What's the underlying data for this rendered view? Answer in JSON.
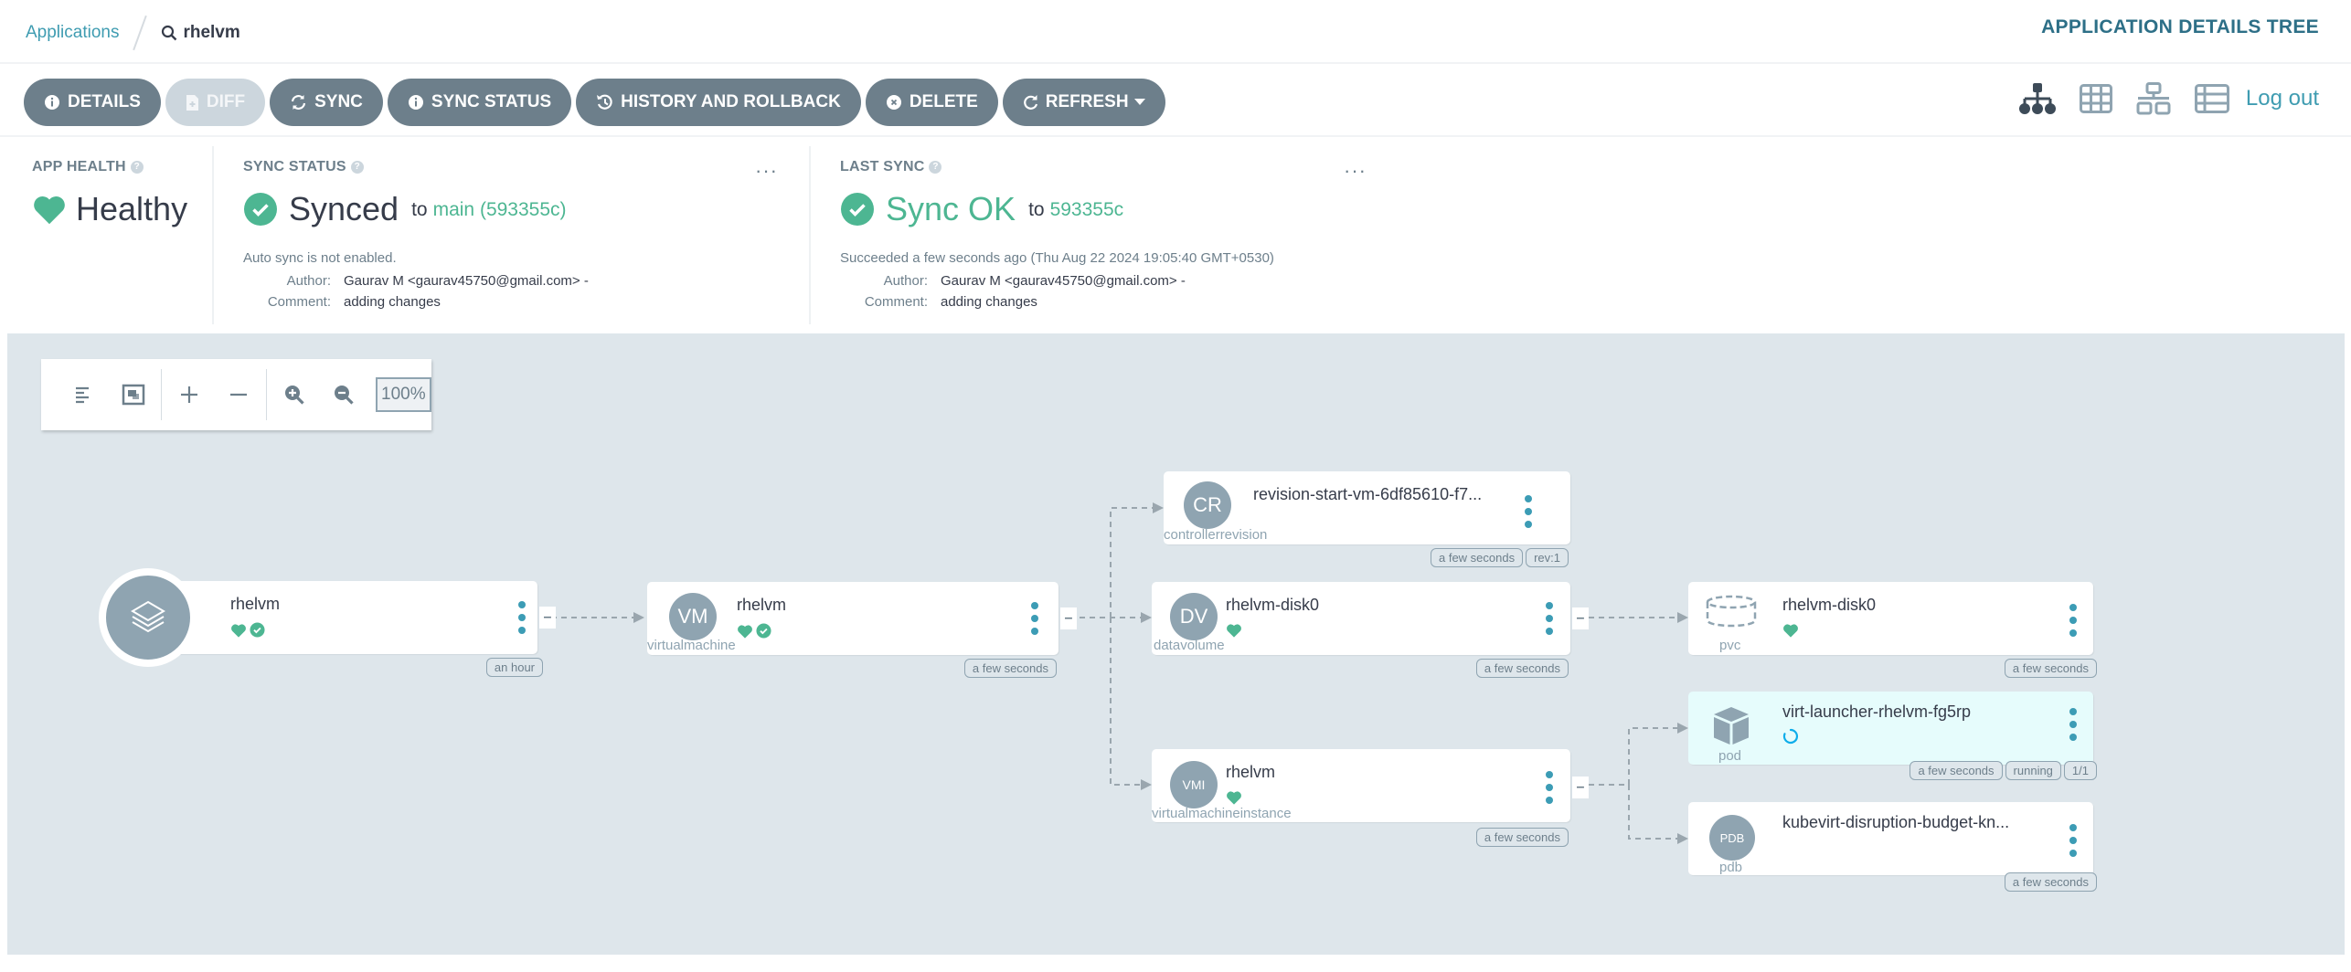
{
  "breadcrumb": {
    "parent": "Applications",
    "current": "rhelvm"
  },
  "page_title": "APPLICATION DETAILS TREE",
  "actions": [
    {
      "label": "DETAILS",
      "icon": "info-circle-icon",
      "disabled": false
    },
    {
      "label": "DIFF",
      "icon": "file-diff-icon",
      "disabled": true
    },
    {
      "label": "SYNC",
      "icon": "sync-icon",
      "disabled": false
    },
    {
      "label": "SYNC STATUS",
      "icon": "info-circle-icon",
      "disabled": false
    },
    {
      "label": "HISTORY AND ROLLBACK",
      "icon": "history-icon",
      "disabled": false
    },
    {
      "label": "DELETE",
      "icon": "times-circle-icon",
      "disabled": false
    },
    {
      "label": "REFRESH",
      "icon": "redo-icon",
      "disabled": false,
      "dropdown": true
    }
  ],
  "view_modes": [
    "tree-view-icon",
    "pods-view-icon",
    "network-view-icon",
    "list-view-icon"
  ],
  "logout_label": "Log out",
  "status": {
    "app_health": {
      "label": "APP HEALTH",
      "value": "Healthy",
      "color": "#4db692"
    },
    "sync_status": {
      "label": "SYNC STATUS",
      "value": "Synced",
      "to": "to",
      "revision": "main (593355c)",
      "note": "Auto sync is not enabled.",
      "author_label": "Author:",
      "author": "Gaurav M <gaurav45750@gmail.com> -",
      "comment_label": "Comment:",
      "comment": "adding changes"
    },
    "last_sync": {
      "label": "LAST SYNC",
      "value": "Sync OK",
      "to": "to",
      "revision": "593355c",
      "note": "Succeeded a few seconds ago (Thu Aug 22 2024 19:05:40 GMT+0530)",
      "author_label": "Author:",
      "author": "Gaurav M <gaurav45750@gmail.com> -",
      "comment_label": "Comment:",
      "comment": "adding changes"
    },
    "more_label": "···"
  },
  "graph_toolbar": {
    "zoom_level": "100%"
  },
  "graph": {
    "root": {
      "name": "rhelvm",
      "health": "healthy",
      "sync": "synced",
      "age": "an hour"
    },
    "vm": {
      "abbr": "VM",
      "kind": "virtualmachine",
      "name": "rhelvm",
      "health": "healthy",
      "sync": "synced",
      "age": "a few seconds"
    },
    "cr": {
      "abbr": "CR",
      "kind": "controllerrevision",
      "name": "revision-start-vm-6df85610-f7...",
      "age": "a few seconds",
      "extra": "rev:1"
    },
    "dv": {
      "abbr": "DV",
      "kind": "datavolume",
      "name": "rhelvm-disk0",
      "health": "healthy",
      "age": "a few seconds"
    },
    "vmi": {
      "abbr": "VMI",
      "kind": "virtualmachineinstance",
      "name": "rhelvm",
      "health": "healthy",
      "age": "a few seconds"
    },
    "pvc": {
      "kind": "pvc",
      "name": "rhelvm-disk0",
      "health": "healthy",
      "age": "a few seconds"
    },
    "pod": {
      "kind": "pod",
      "name": "virt-launcher-rhelvm-fg5rp",
      "health": "progressing",
      "age": "a few seconds",
      "phase": "running",
      "ready": "1/1"
    },
    "pdb": {
      "abbr": "PDB",
      "kind": "pdb",
      "name": "kubevirt-disruption-budget-kn...",
      "age": "a few seconds"
    }
  },
  "colors": {
    "healthy": "#4db692",
    "accent": "#3f9cb1",
    "button": "#6d7f8b",
    "canvas": "#dee6eb",
    "progressing": "#0dadea"
  }
}
